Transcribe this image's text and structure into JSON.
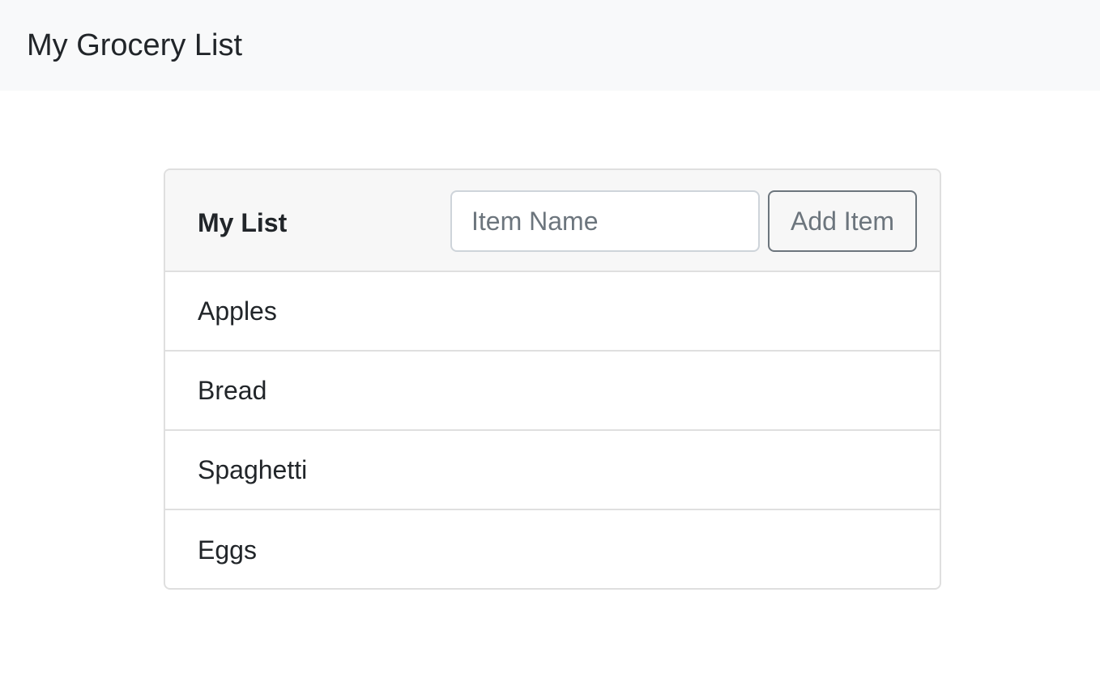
{
  "navbar": {
    "brand": "My Grocery List"
  },
  "card": {
    "title": "My List",
    "input": {
      "value": "",
      "placeholder": "Item Name"
    },
    "add_button_label": "Add Item",
    "items": [
      {
        "label": "Apples"
      },
      {
        "label": "Bread"
      },
      {
        "label": "Spaghetti"
      },
      {
        "label": "Eggs"
      }
    ]
  },
  "colors": {
    "navbar_bg": "#f8f9fa",
    "card_header_bg": "#f7f7f7",
    "border": "#dfdfdf",
    "secondary": "#6c757d",
    "text": "#212529"
  }
}
